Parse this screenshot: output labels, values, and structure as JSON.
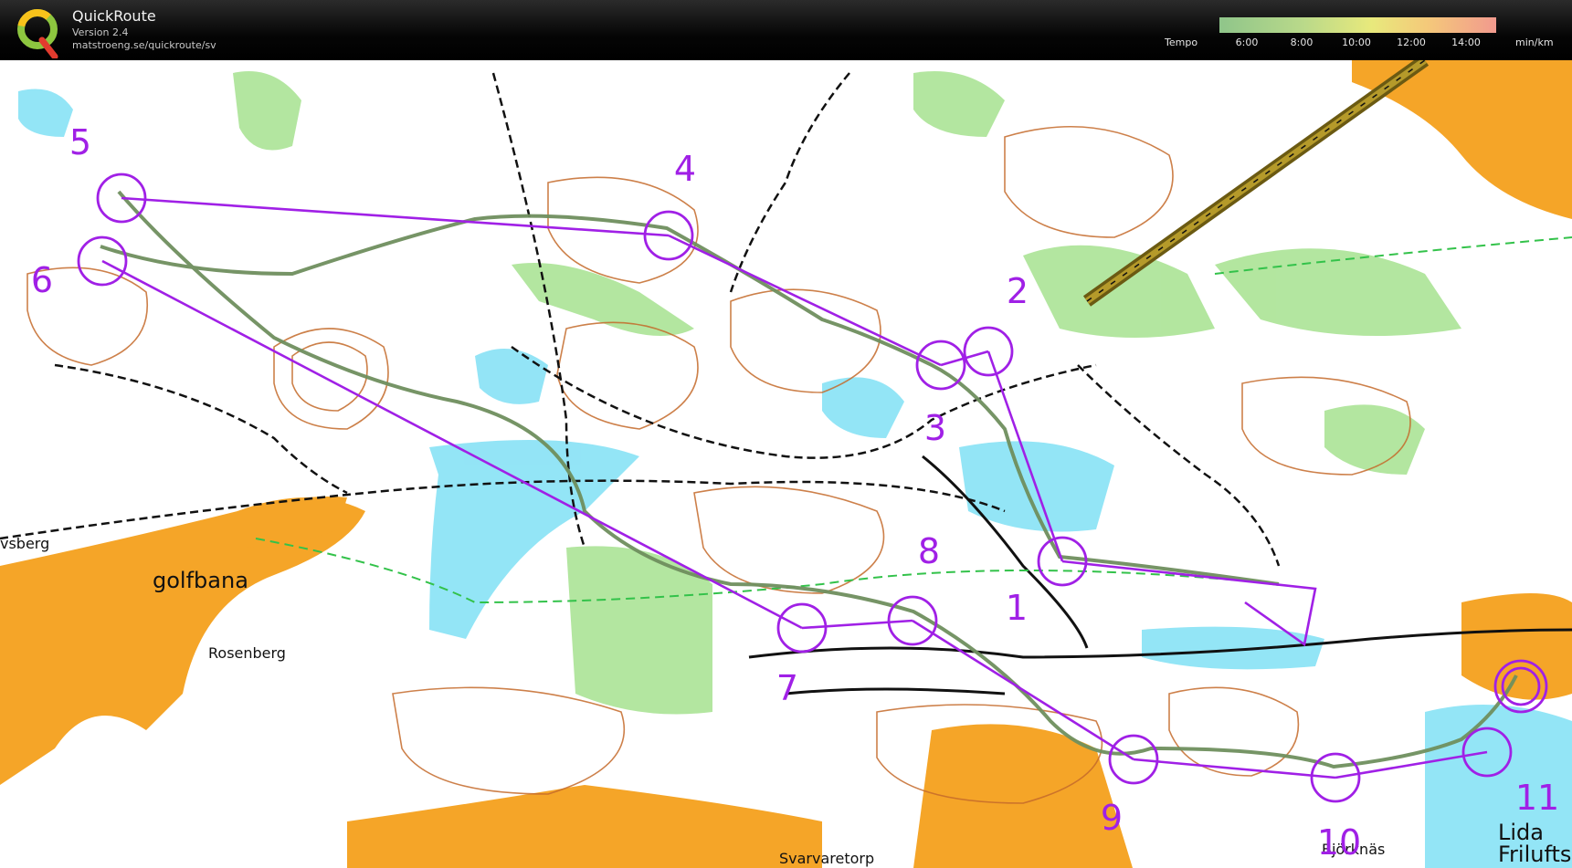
{
  "app": {
    "name": "QuickRoute",
    "version": "Version 2.4",
    "url": "matstroeng.se/quickroute/sv"
  },
  "legend": {
    "label": "Tempo",
    "ticks": [
      "6:00",
      "8:00",
      "10:00",
      "12:00",
      "14:00"
    ],
    "unit": "min/km",
    "colors": [
      "#8fc58a",
      "#e8e97c",
      "#f29a8e"
    ]
  },
  "map": {
    "place_names": {
      "vsberg": "vsberg",
      "golfbana": "golfbana",
      "rosenberg": "Rosenberg",
      "svarvaretorp": "Svarvaretorp",
      "bjorknas": "Björknäs",
      "lida": "Lida",
      "friluft": "Frilufts"
    },
    "controls": [
      "1",
      "2",
      "3",
      "4",
      "5",
      "6",
      "7",
      "8",
      "9",
      "10",
      "11"
    ],
    "colors": {
      "course": "#a020e6",
      "route": "#6f8f5e",
      "contour": "#c46a2a",
      "open_land": "#f6a623",
      "water": "#4fd3f0",
      "vegetation": "#9be28a",
      "track": "#111111"
    }
  }
}
